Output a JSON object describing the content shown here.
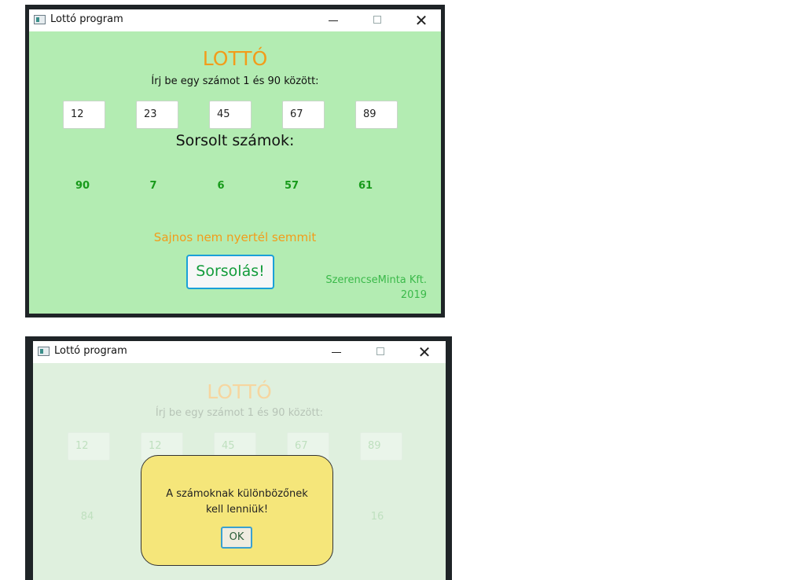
{
  "window1": {
    "title": "Lottó program",
    "heading": "LOTTÓ",
    "prompt": "Írj be egy számot 1 és 90 között:",
    "inputs": [
      "12",
      "23",
      "45",
      "67",
      "89"
    ],
    "drawn_label": "Sorsolt számok:",
    "drawn": [
      "90",
      "7",
      "6",
      "57",
      "61"
    ],
    "result": "Sajnos nem nyertél semmit",
    "button": "Sorsolás!",
    "company": "SzerencseMinta Kft.",
    "year": "2019"
  },
  "window2": {
    "title": "Lottó program",
    "heading": "LOTTÓ",
    "prompt": "Írj be egy számot 1 és 90 között:",
    "inputs": [
      "12",
      "12",
      "45",
      "67",
      "89"
    ],
    "drawn_visible": [
      "84",
      "16"
    ],
    "dialog": {
      "line1": "A számoknak különbözőnek",
      "line2": "kell lenniük!",
      "ok": "OK"
    }
  },
  "colors": {
    "client_bg": "#b3ecb2",
    "client_bg_dim": "#dff0de",
    "accent_orange": "#f29c1a",
    "number_green": "#179a1a",
    "button_border": "#1aa0d8",
    "dialog_bg": "#f5e67a"
  }
}
